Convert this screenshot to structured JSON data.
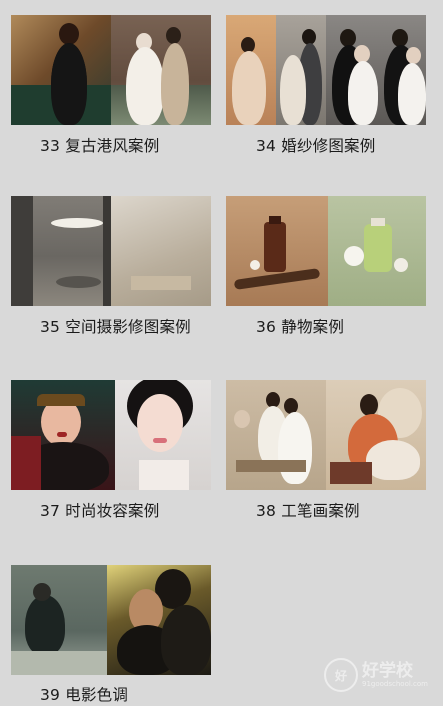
{
  "cases": [
    {
      "label": "33 复古港风案例",
      "image": "retro-hongkong-style-photo"
    },
    {
      "label": "34 婚纱修图案例",
      "image": "wedding-retouch-photo"
    },
    {
      "label": "35 空间摄影修图案例",
      "image": "space-photography-photo"
    },
    {
      "label": "36 静物案例",
      "image": "still-life-photo"
    },
    {
      "label": "37 时尚妆容案例",
      "image": "fashion-makeup-photo"
    },
    {
      "label": "38 工笔画案例",
      "image": "gongbi-painting-photo"
    },
    {
      "label": "39 电影色调",
      "image": "film-tone-photo"
    }
  ],
  "watermark": {
    "brand": "好学校",
    "url": "91goodschool.com"
  },
  "colors": {
    "background": "#d9d9d9",
    "label_text": "#1b1b1b"
  }
}
